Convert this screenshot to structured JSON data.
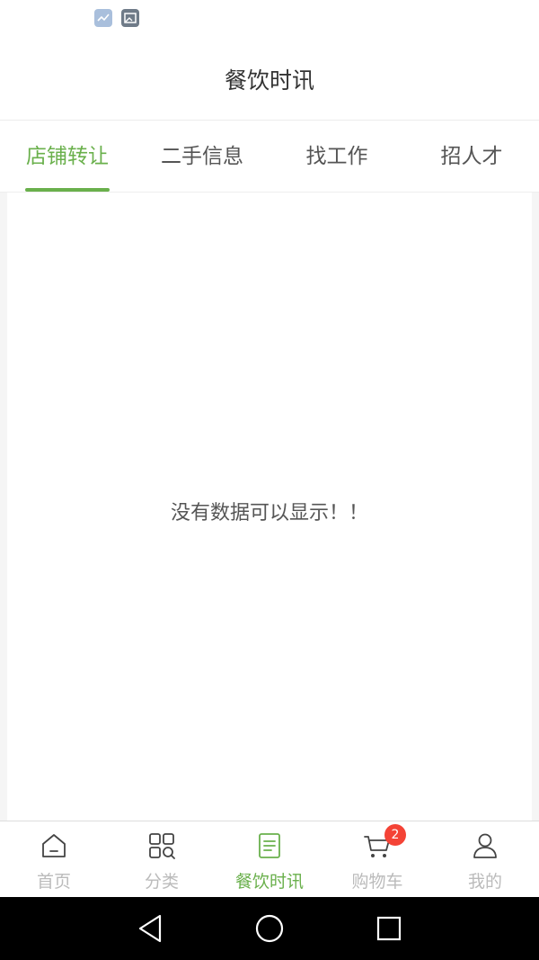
{
  "header": {
    "title": "餐饮时讯"
  },
  "tabs": [
    {
      "label": "店铺转让",
      "active": true
    },
    {
      "label": "二手信息",
      "active": false
    },
    {
      "label": "找工作",
      "active": false
    },
    {
      "label": "招人才",
      "active": false
    }
  ],
  "content": {
    "empty_message": "没有数据可以显示！！"
  },
  "bottom_nav": [
    {
      "label": "首页",
      "icon": "home-icon",
      "active": false
    },
    {
      "label": "分类",
      "icon": "category-icon",
      "active": false
    },
    {
      "label": "餐饮时讯",
      "icon": "news-icon",
      "active": true
    },
    {
      "label": "购物车",
      "icon": "cart-icon",
      "active": false,
      "badge": "2"
    },
    {
      "label": "我的",
      "icon": "user-icon",
      "active": false
    }
  ],
  "colors": {
    "accent": "#6ab04c",
    "badge": "#f44336",
    "inactive_nav": "#bbbbbb"
  }
}
